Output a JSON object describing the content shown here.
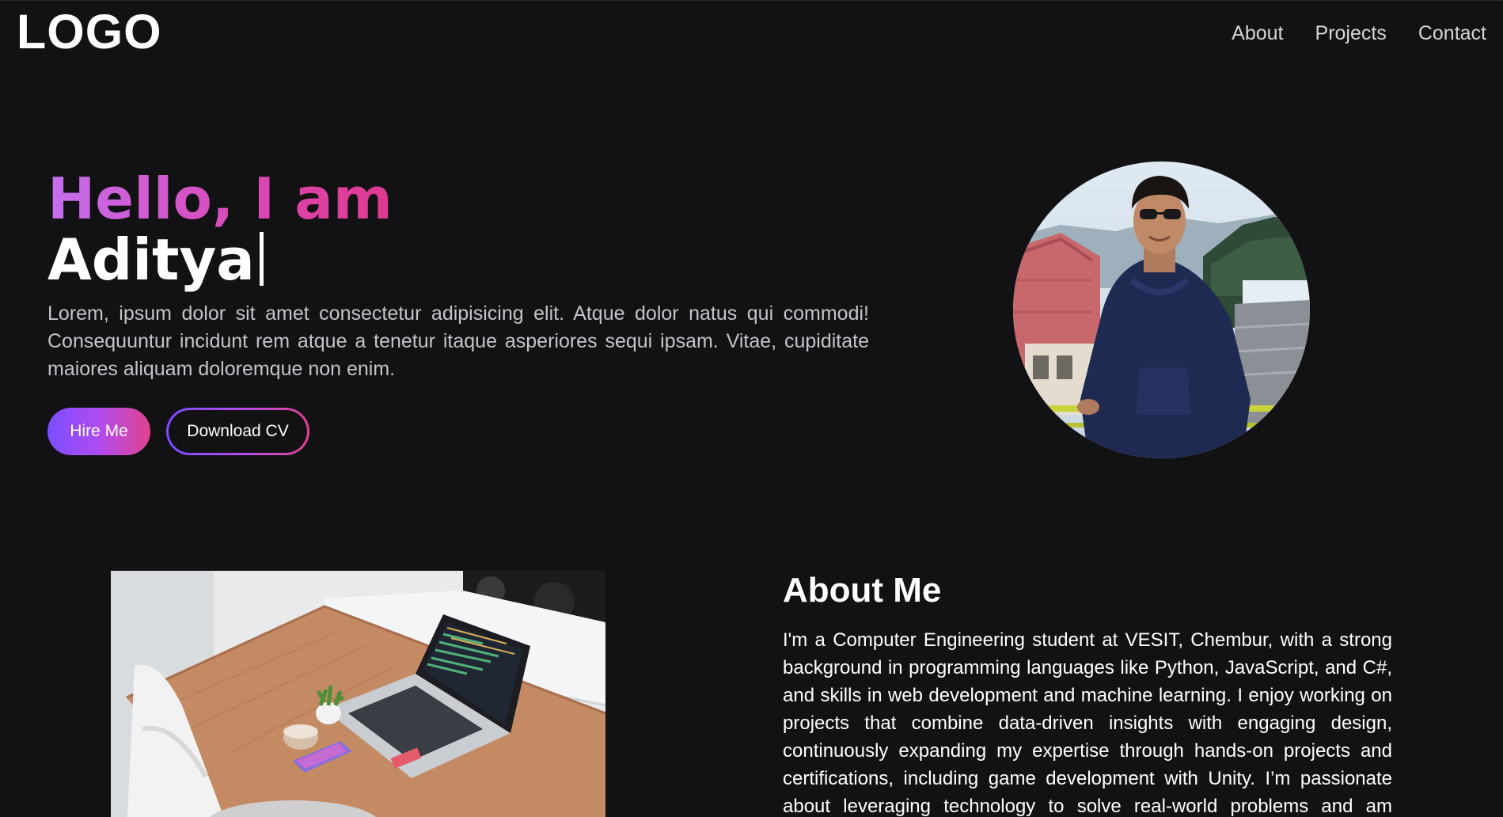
{
  "header": {
    "logo": "LOGO",
    "nav": [
      {
        "label": "About"
      },
      {
        "label": "Projects"
      },
      {
        "label": "Contact"
      }
    ]
  },
  "hero": {
    "greeting": "Hello, I am",
    "name": "Aditya",
    "description": "Lorem, ipsum dolor sit amet consectetur adipisicing elit. Atque dolor natus qui commodi! Consequuntur incidunt rem atque a tenetur itaque asperiores sequi ipsam. Vitae, cupiditate maiores aliquam doloremque non enim.",
    "hire_label": "Hire Me",
    "cv_label": "Download CV"
  },
  "about": {
    "title": "About Me",
    "text": "I'm a Computer Engineering student at VESIT, Chembur, with a strong background in programming languages like Python, JavaScript, and C#, and skills in web development and machine learning. I enjoy working on projects that combine data-driven insights with engaging design, continuously expanding my expertise through hands-on projects and certifications, including game development with Unity. I’m passionate about leveraging technology to solve real-world problems and am always eager to learn,"
  },
  "colors": {
    "background": "#121214",
    "accent_purple": "#7b4dff",
    "accent_pink": "#e0428e",
    "greeting_gradient_start": "#c56fee",
    "greeting_gradient_end": "#e0388e"
  }
}
